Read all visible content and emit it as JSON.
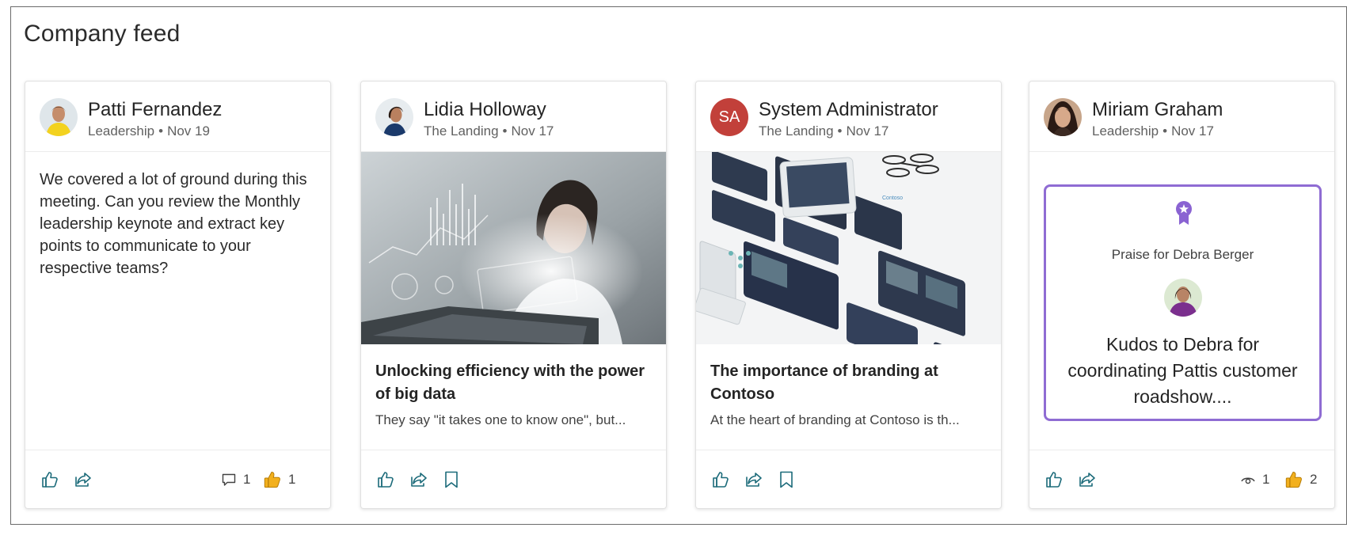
{
  "feed": {
    "title": "Company feed",
    "cards": [
      {
        "author": "Patti Fernandez",
        "community": "Leadership",
        "date": "Nov 19",
        "body": "We covered a lot of ground during this meeting. Can you review the Monthly leadership keynote and extract key points to communicate to your respective teams?",
        "comments_count": "1",
        "reactions_count": "1"
      },
      {
        "author": "Lidia Holloway",
        "community": "The Landing",
        "date": "Nov 17",
        "title": "Unlocking efficiency with the power of big data",
        "snippet": "They say \"it takes one to know one\", but..."
      },
      {
        "author": "System Administrator",
        "initials": "SA",
        "community": "The Landing",
        "date": "Nov 17",
        "title": "The importance of branding at Contoso",
        "snippet": "At the heart of branding at Contoso is th..."
      },
      {
        "author": "Miriam Graham",
        "community": "Leadership",
        "date": "Nov 17",
        "praise_label": "Praise for Debra Berger",
        "praise_message": "Kudos to Debra for coordinating Pattis customer roadshow....",
        "views_count": "1",
        "reactions_count": "2"
      }
    ],
    "separator": "•"
  },
  "icons": {
    "like": "like-icon",
    "share": "share-icon",
    "bookmark": "bookmark-icon",
    "comment": "comment-icon",
    "views": "eye-icon",
    "reaction": "thumbs-up-emoji-icon",
    "badge": "praise-badge-icon"
  },
  "colors": {
    "accent_teal": "#1c6b7a",
    "praise_border": "#8f6cd3",
    "initials_avatar": "#c2403a",
    "reaction_yellow": "#f2b01e"
  }
}
